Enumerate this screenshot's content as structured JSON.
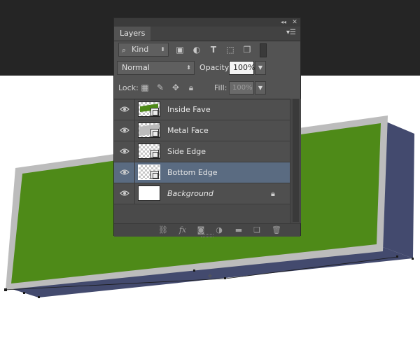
{
  "panel": {
    "tab_label": "Layers",
    "collapse_icon": "double-chevron-left-icon",
    "close_icon": "close-icon",
    "menu_icon": "panel-menu-icon"
  },
  "filter": {
    "kind_label": "Kind",
    "icons": [
      "pixel-layer-filter-icon",
      "adjustment-layer-filter-icon",
      "type-layer-filter-icon",
      "shape-layer-filter-icon",
      "smart-object-filter-icon",
      "filter-toggle-icon"
    ]
  },
  "blend": {
    "mode": "Normal",
    "opacity_label": "Opacity:",
    "opacity_value": "100%"
  },
  "lock": {
    "label": "Lock:",
    "icons": [
      "lock-transparent-pixels-icon",
      "lock-image-pixels-icon",
      "lock-position-icon",
      "lock-all-icon"
    ],
    "fill_label": "Fill:",
    "fill_value": "100%"
  },
  "layers": [
    {
      "name": "Inside Fave",
      "visible": true,
      "selected": false,
      "thumb": "smart-object-green"
    },
    {
      "name": "Metal Face",
      "visible": true,
      "selected": false,
      "thumb": "smart-object-gray"
    },
    {
      "name": "Side Edge",
      "visible": true,
      "selected": false,
      "thumb": "smart-object-transparent"
    },
    {
      "name": "Bottom Edge",
      "visible": true,
      "selected": true,
      "thumb": "smart-object-transparent"
    },
    {
      "name": "Background",
      "visible": true,
      "selected": false,
      "thumb": "white",
      "locked": true
    }
  ],
  "bottom_icons": [
    "link-layers-icon",
    "fx-icon",
    "add-mask-icon",
    "adjustment-layer-icon",
    "group-folder-icon",
    "new-layer-icon",
    "trash-icon"
  ],
  "colors": {
    "canvas_green": "#4e8a18",
    "metal_gray": "#bcbcbc",
    "side_navy": "#434a6e",
    "selection_blue": "#5a6b81",
    "panel_bg": "#535353",
    "app_dark": "#252525"
  }
}
